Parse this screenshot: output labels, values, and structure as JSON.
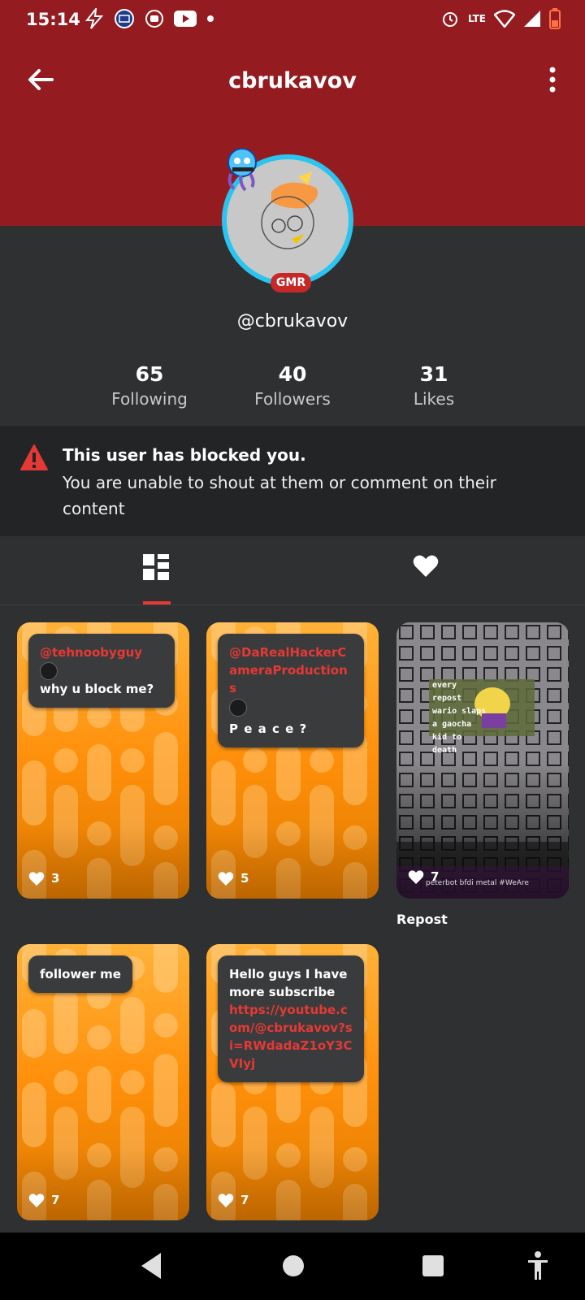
{
  "status_bar": {
    "time": "15:14",
    "network": "LTE"
  },
  "header": {
    "title": "cbrukavov",
    "back_icon": "arrow-left-icon",
    "more_icon": "more-vertical-icon"
  },
  "profile": {
    "badge": "GMR",
    "handle": "@cbrukavov",
    "ring_color": "#29c4ef"
  },
  "stats": [
    {
      "value": "65",
      "label": "Following"
    },
    {
      "value": "40",
      "label": "Followers"
    },
    {
      "value": "31",
      "label": "Likes"
    }
  ],
  "blocked": {
    "title": "This user has blocked you.",
    "body": "You are unable to shout at them or comment on their content"
  },
  "tabs": {
    "active": "posts-grid",
    "items": [
      "grid-icon",
      "heart-icon"
    ]
  },
  "posts": [
    {
      "mention": "@tehnoobyguy",
      "text": "why u block me?",
      "likes": "3"
    },
    {
      "mention": "@DaRealHackerCameraProductions",
      "text": "P e a c e ?",
      "likes": "5"
    },
    {
      "text": "follower me",
      "likes": "7"
    },
    {
      "text": "Hello guys I have more subscribe",
      "link": "https://youtube.com/@cbrukavov?si=RWdadaZ1oY3CVIyj",
      "likes": "7"
    }
  ],
  "repost": {
    "overlay_text": "every repost wario slaps a gaocha kid to death",
    "caption": "peterbot bfdi metal #WeAre",
    "likes": "7",
    "label": "Repost"
  },
  "colors": {
    "brand_red": "#941c20",
    "accent_red": "#e53935",
    "background": "#2e3032",
    "card_orange": "#ff8f0a"
  }
}
